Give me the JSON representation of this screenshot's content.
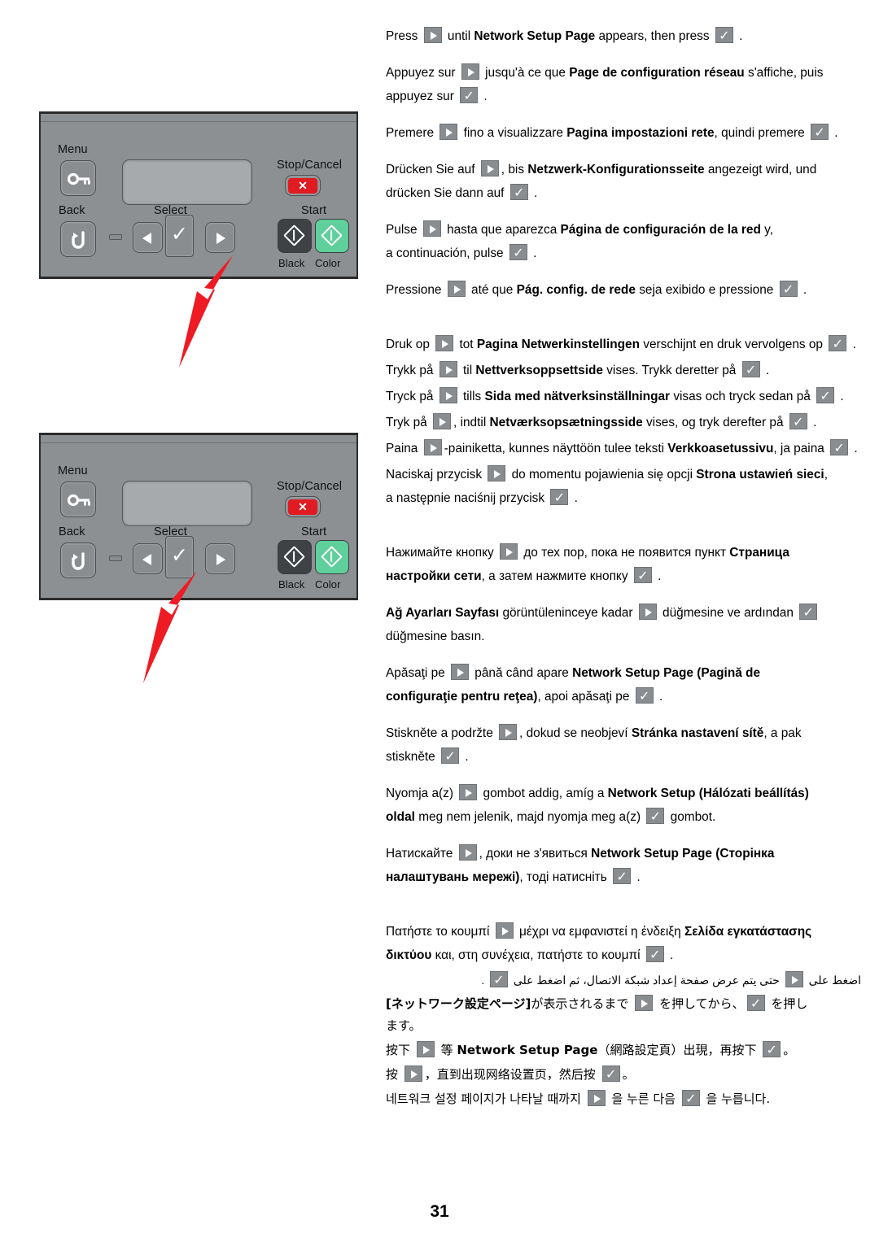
{
  "page": {
    "number": "31"
  },
  "panels": [
    {
      "id": "panel-1",
      "labels": {
        "menu": "Menu",
        "stop_cancel": "Stop/Cancel",
        "back": "Back",
        "select": "Select",
        "start": "Start",
        "black": "Black",
        "color": "Color"
      },
      "stop_glyph": "✕",
      "check_glyph": "✓",
      "pointer_target": "right-arrow-button",
      "pointer_color": "#ee1b24"
    },
    {
      "id": "panel-2",
      "labels": {
        "menu": "Menu",
        "stop_cancel": "Stop/Cancel",
        "back": "Back",
        "select": "Select",
        "start": "Start",
        "black": "Black",
        "color": "Color"
      },
      "stop_glyph": "✕",
      "check_glyph": "✓",
      "pointer_target": "select-check-button",
      "pointer_color": "#ee1b24"
    }
  ],
  "instructions": {
    "en": {
      "pre": "Press",
      "mid": "until",
      "bold": "Network Setup Page",
      "post": "appears, then press",
      "end": "."
    },
    "fr": {
      "pre": "Appuyez sur",
      "mid": "jusqu'à ce que",
      "bold": "Page de configuration réseau",
      "post": "s'affiche, puis",
      "line2_pre": "appuyez sur",
      "end": "."
    },
    "it": {
      "pre": "Premere",
      "mid": "fino a visualizzare",
      "bold": "Pagina impostazioni rete",
      "post": ", quindi premere",
      "end": "."
    },
    "de": {
      "pre": "Drücken Sie auf",
      "mid": ", bis",
      "bold": "Netzwerk-Konfigurationsseite",
      "post": "angezeigt wird, und",
      "line2_pre": "drücken Sie dann auf",
      "end": "."
    },
    "es": {
      "pre": "Pulse",
      "mid": "hasta que aparezca",
      "bold": "Página de configuración de la red",
      "post": "y,",
      "line2_pre": "a continuación, pulse",
      "end": "."
    },
    "pt": {
      "pre": "Pressione",
      "mid": "até que",
      "bold": "Pág. config. de rede",
      "post": "seja exibido e pressione",
      "end": "."
    },
    "nl": {
      "pre": "Druk op",
      "mid": "tot",
      "bold": "Pagina Netwerkinstellingen",
      "post": "verschijnt en druk vervolgens op",
      "end": "."
    },
    "no": {
      "pre": "Trykk på",
      "mid": "til",
      "bold": "Nettverksoppsettside",
      "post": "vises. Trykk deretter på",
      "end": "."
    },
    "sv": {
      "pre": "Tryck på",
      "mid": "tills",
      "bold": "Sida med nätverksinställningar",
      "post": "visas och tryck sedan på",
      "end": "."
    },
    "da": {
      "pre": "Tryk på",
      "mid": ", indtil",
      "bold": "Netværksopsætningsside",
      "post": "vises, og tryk derefter på",
      "end": "."
    },
    "fi": {
      "pre": "Paina",
      "mid": "-painiketta, kunnes näyttöön tulee teksti",
      "bold": "Verkkoasetussivu",
      "post": ", ja paina",
      "end": "."
    },
    "pl": {
      "pre": "Naciskaj przycisk",
      "mid": "do momentu pojawienia się opcji",
      "bold": "Strona ustawień sieci",
      "post": ",",
      "line2_pre": "a następnie naciśnij przycisk",
      "end": "."
    },
    "ru": {
      "pre": "Нажимайте кнопку",
      "mid": "до тех пор, пока не появится пункт",
      "bold": "Страница",
      "bold2": "настройки сети",
      "post": ", а затем нажмите кнопку",
      "end": "."
    },
    "tr": {
      "bold": "Ağ Ayarları Sayfası",
      "mid": "görüntüleninceye kadar",
      "post": "düğmesine ve ardından",
      "line2_pre": "düğmesine basın.",
      "end": ""
    },
    "ro": {
      "pre": "Apăsaţi pe",
      "mid": "până când apare",
      "bold": "Network Setup Page (Pagină de",
      "bold2": "configuraţie pentru reţea)",
      "post": ", apoi apăsaţi pe",
      "end": "."
    },
    "cs": {
      "pre": "Stiskněte a podržte",
      "mid": ", dokud se neobjeví",
      "bold": "Stránka nastavení sítě",
      "post": ", a pak",
      "line2_pre": "stiskněte",
      "end": "."
    },
    "hu": {
      "pre": "Nyomja a(z)",
      "mid": "gombot addig, amíg a",
      "bold": "Network Setup (Hálózati beállítás)",
      "bold2": "oldal",
      "post": "meg nem jelenik, majd nyomja meg a(z)",
      "end": "gombot."
    },
    "uk": {
      "pre": "Натискайте",
      "mid": ", доки не з'явиться",
      "bold": "Network Setup Page (Сторінка",
      "bold2": "налаштувань мережі)",
      "post": ", тоді натисніть",
      "end": "."
    },
    "el": {
      "pre": "Πατήστε το κουμπί",
      "mid": "μέχρι να εμφανιστεί η ένδειξη",
      "bold": "Σελίδα εγκατάστασης",
      "bold2": "δικτύου",
      "post": "και, στη συνέχεια, πατήστε το κουμπί",
      "end": "."
    },
    "ar": {
      "pre": "اضغط على",
      "mid": "حتى يتم عرض صفحة إعداد شبكة الاتصال، ثم اضغط على",
      "end": "."
    },
    "ja": {
      "bold": "[ネットワーク設定ページ]",
      "mid": "が表示されるまで",
      "post": "を押してから、",
      "end": "を押し",
      "line2": "ます。"
    },
    "zh_tw": {
      "pre": "按下",
      "mid": "等",
      "bold": "Network Setup Page",
      "post": "（網路設定頁）出現，再按下",
      "end": "。"
    },
    "zh_cn": {
      "pre": "按",
      "mid": "，直到出现网络设置页，然后按",
      "end": "。"
    },
    "ko": {
      "pre": "네트워크 설정 페이지가 나타날 때까지",
      "mid": "을 누른 다음",
      "end": "을 누릅니다."
    }
  },
  "icons": {
    "right_arrow": "right-arrow-key-icon",
    "check": "check-key-icon",
    "menu_key": "key-icon",
    "back_key": "back-arrow-icon",
    "stop_key": "x-icon",
    "start_key": "start-diamond-icon"
  }
}
